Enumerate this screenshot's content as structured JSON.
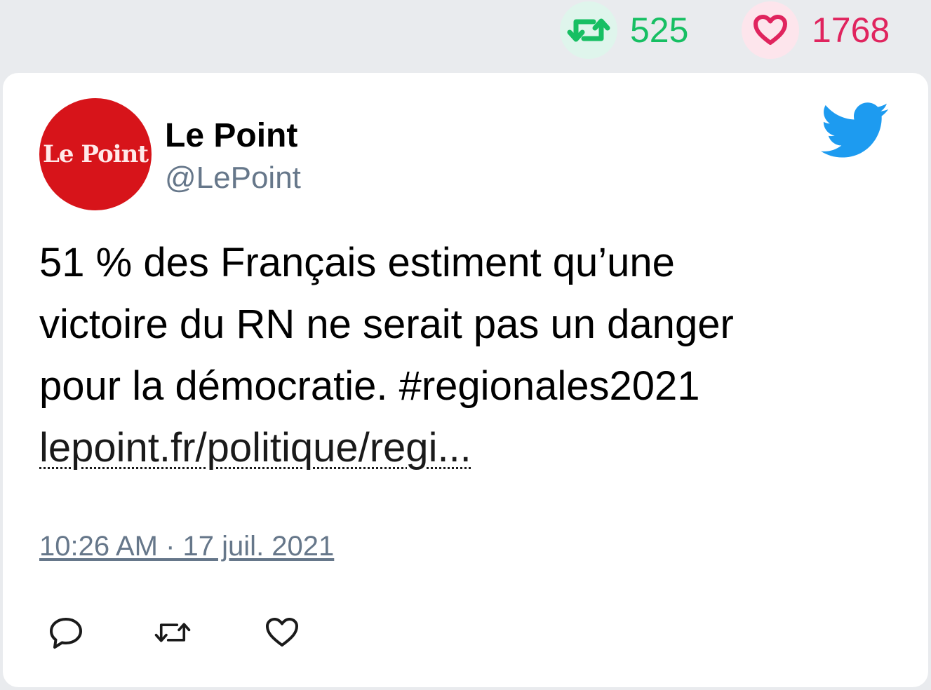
{
  "stats": {
    "retweet_count": "525",
    "like_count": "1768",
    "retweet_color": "#17bf63",
    "like_color": "#e0245e"
  },
  "tweet": {
    "avatar_text": "Le Point",
    "author_name": "Le Point",
    "author_handle": "@LePoint",
    "text": "51 % des Français estiment qu’une\nvictoire du RN ne serait pas un danger\npour la démocratie. #regionales2021",
    "link": "lepoint.fr/politique/regi...",
    "timestamp": "10:26 AM · 17 juil. 2021",
    "brand_icon": "twitter-bird-icon",
    "brand_color": "#1d9bf0"
  },
  "actions": {
    "icons": [
      "reply-icon",
      "retweet-icon",
      "like-icon"
    ]
  }
}
